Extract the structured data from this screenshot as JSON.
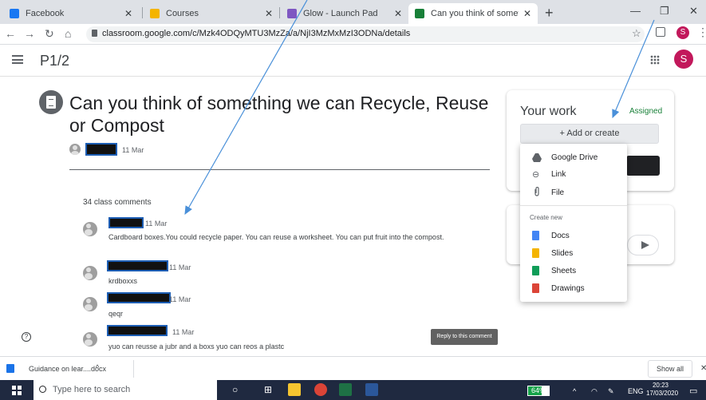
{
  "browser": {
    "tabs": [
      {
        "title": "Facebook",
        "color": "#1877f2"
      },
      {
        "title": "Courses",
        "color": "#f4b400"
      },
      {
        "title": "Glow - Launch Pad",
        "color": "#7e57c2"
      },
      {
        "title": "Can you think of something we c",
        "color": "#188038"
      }
    ],
    "url": "classroom.google.com/c/Mzk4ODQyMTU3MzZa/a/NjI3MzMxMzI3ODNa/details",
    "profile_initial": "S"
  },
  "classroom": {
    "class_name": "P1/2",
    "profile_initial": "S"
  },
  "assignment": {
    "title": "Can you think of something we can Recycle, Reuse or Compost",
    "date": "11 Mar"
  },
  "comments": {
    "count_label": "34 class comments",
    "items": [
      {
        "date": "11 Mar",
        "text": "Cardboard boxes.You could recycle paper. You can reuse a worksheet. You can put fruit into the compost."
      },
      {
        "date": "11 Mar",
        "text": "krdboxxs"
      },
      {
        "date": "11 Mar",
        "text": "qeqr"
      },
      {
        "date": "11 Mar",
        "text": "yuo can reusse a jubr and a boxs yuo can reos a plastc"
      }
    ],
    "reply_tooltip": "Reply to this comment"
  },
  "your_work": {
    "heading": "Your work",
    "status": "Assigned",
    "status_color": "#188038",
    "add_label": "+ Add or create"
  },
  "add_menu": {
    "items": [
      {
        "label": "Google Drive",
        "icon": "google-drive-icon"
      },
      {
        "label": "Link",
        "icon": "link-icon"
      },
      {
        "label": "File",
        "icon": "paperclip-icon"
      }
    ],
    "create_new_label": "Create new",
    "create_items": [
      {
        "label": "Docs",
        "icon": "docs-icon",
        "color": "#4285f4"
      },
      {
        "label": "Slides",
        "icon": "slides-icon",
        "color": "#f4b400"
      },
      {
        "label": "Sheets",
        "icon": "sheets-icon",
        "color": "#0f9d58"
      },
      {
        "label": "Drawings",
        "icon": "drawings-icon",
        "color": "#db4437"
      }
    ]
  },
  "downloads": {
    "file_name": "Guidance on lear....docx",
    "show_all": "Show all"
  },
  "taskbar": {
    "search_placeholder": "Type here to search",
    "battery": "64%",
    "battery_level": 0.64,
    "language": "ENG",
    "time": "20:23",
    "date": "17/03/2020"
  }
}
